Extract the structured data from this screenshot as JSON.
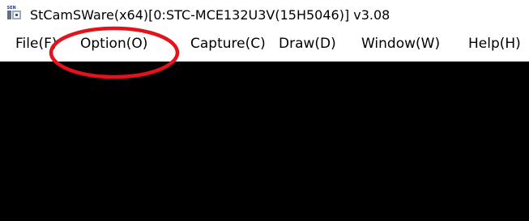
{
  "window": {
    "title": "StCamSWare(x64)[0:STC-MCE132U3V(15H5046)] v3.08",
    "icon_name": "camera-app-icon"
  },
  "menubar": {
    "items": [
      {
        "label": "File(F)"
      },
      {
        "label": "Option(O)"
      },
      {
        "label": "Capture(C)"
      },
      {
        "label": "Draw(D)"
      },
      {
        "label": "Window(W)"
      },
      {
        "label": "Help(H)"
      }
    ]
  },
  "annotation": {
    "shape": "ellipse",
    "target": "Option(O)",
    "color": "#e3121b"
  },
  "viewport": {
    "background": "#000000"
  }
}
